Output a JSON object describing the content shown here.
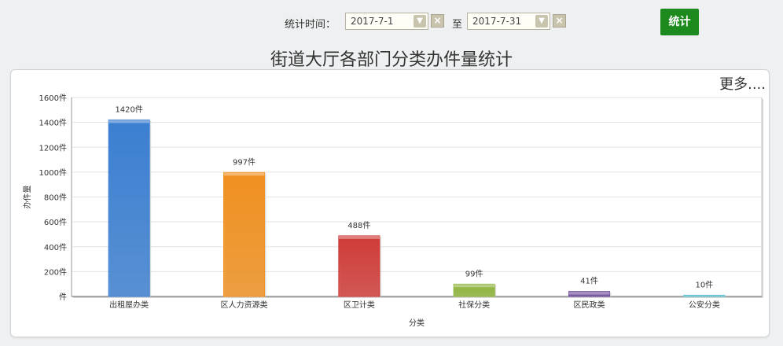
{
  "filter": {
    "label": "统计时间：",
    "start_date": "2017-7-1",
    "separator": "至",
    "end_date": "2017-7-31",
    "submit_label": "统计"
  },
  "more_link": "更多....",
  "colors": {
    "submit_bg": "#1d8a1d",
    "series": [
      "#3b7fd1",
      "#f0901f",
      "#cf3b37",
      "#8db33a",
      "#6c4a9b",
      "#3fb5c4"
    ]
  },
  "chart_data": {
    "type": "bar",
    "title": "街道大厅各部门分类办件量统计",
    "xlabel": "分类",
    "ylabel": "办件量",
    "categories": [
      "出租屋办类",
      "区人力资源类",
      "区卫计类",
      "社保分类",
      "区民政类",
      "公安分类"
    ],
    "values": [
      1420,
      997,
      488,
      99,
      41,
      10
    ],
    "data_labels": [
      "1420件",
      "997件",
      "488件",
      "99件",
      "41件",
      "10件"
    ],
    "unit": "件",
    "ylim": [
      0,
      1600
    ],
    "yticks": [
      0,
      200,
      400,
      600,
      800,
      1000,
      1200,
      1400,
      1600
    ],
    "ytick_labels": [
      "件",
      "200件",
      "400件",
      "600件",
      "800件",
      "1000件",
      "1200件",
      "1400件",
      "1600件"
    ],
    "grid": true
  }
}
